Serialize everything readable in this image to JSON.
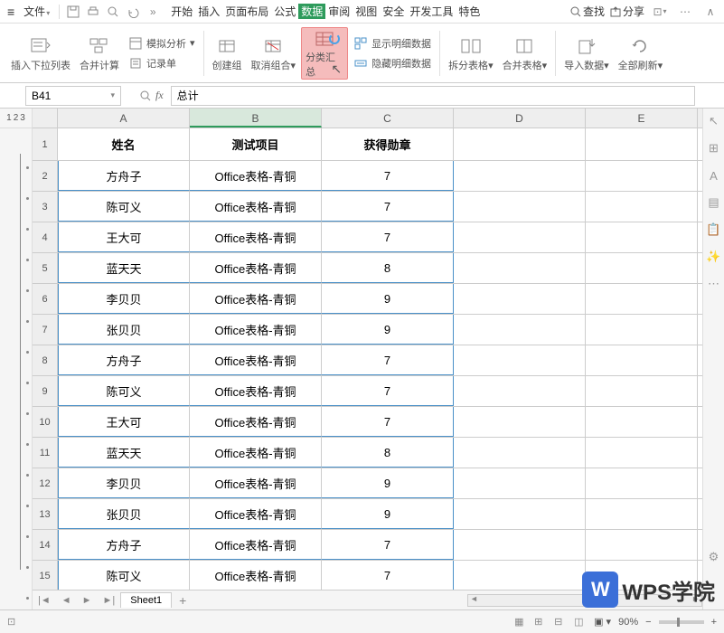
{
  "menubar": {
    "file": "文件",
    "tabs": [
      "开始",
      "插入",
      "页面布局",
      "公式",
      "数据",
      "审阅",
      "视图",
      "安全",
      "开发工具",
      "特色"
    ],
    "active_tab": "数据",
    "search": "查找",
    "share": "分享"
  },
  "ribbon": {
    "insert_dropdown": "插入下拉列表",
    "merge_calc": "合并计算",
    "simulate": "模拟分析",
    "record": "记录单",
    "create_group": "创建组",
    "ungroup": "取消组合",
    "subtotal": "分类汇总",
    "show_detail": "显示明细数据",
    "hide_detail": "隐藏明细数据",
    "split_table": "拆分表格",
    "merge_table": "合并表格",
    "import_data": "导入数据",
    "refresh_all": "全部刷新"
  },
  "formula_bar": {
    "cell_ref": "B41",
    "formula": "总计"
  },
  "outline": {
    "levels": [
      "1",
      "2",
      "3"
    ]
  },
  "columns": [
    "A",
    "B",
    "C",
    "D",
    "E"
  ],
  "table": {
    "headers": [
      "姓名",
      "测试项目",
      "获得勋章"
    ],
    "rows": [
      {
        "n": "1",
        "a": "姓名",
        "b": "测试项目",
        "c": "获得勋章"
      },
      {
        "n": "2",
        "a": "方舟子",
        "b": "Office表格-青铜",
        "c": "7"
      },
      {
        "n": "3",
        "a": "陈可义",
        "b": "Office表格-青铜",
        "c": "7"
      },
      {
        "n": "4",
        "a": "王大可",
        "b": "Office表格-青铜",
        "c": "7"
      },
      {
        "n": "5",
        "a": "蓝天天",
        "b": "Office表格-青铜",
        "c": "8"
      },
      {
        "n": "6",
        "a": "李贝贝",
        "b": "Office表格-青铜",
        "c": "9"
      },
      {
        "n": "7",
        "a": "张贝贝",
        "b": "Office表格-青铜",
        "c": "9"
      },
      {
        "n": "8",
        "a": "方舟子",
        "b": "Office表格-青铜",
        "c": "7"
      },
      {
        "n": "9",
        "a": "陈可义",
        "b": "Office表格-青铜",
        "c": "7"
      },
      {
        "n": "10",
        "a": "王大可",
        "b": "Office表格-青铜",
        "c": "7"
      },
      {
        "n": "11",
        "a": "蓝天天",
        "b": "Office表格-青铜",
        "c": "8"
      },
      {
        "n": "12",
        "a": "李贝贝",
        "b": "Office表格-青铜",
        "c": "9"
      },
      {
        "n": "13",
        "a": "张贝贝",
        "b": "Office表格-青铜",
        "c": "9"
      },
      {
        "n": "14",
        "a": "方舟子",
        "b": "Office表格-青铜",
        "c": "7"
      },
      {
        "n": "15",
        "a": "陈可义",
        "b": "Office表格-青铜",
        "c": "7"
      }
    ]
  },
  "sheet_tab": "Sheet1",
  "statusbar": {
    "zoom": "90%"
  },
  "watermark": "WPS学院"
}
